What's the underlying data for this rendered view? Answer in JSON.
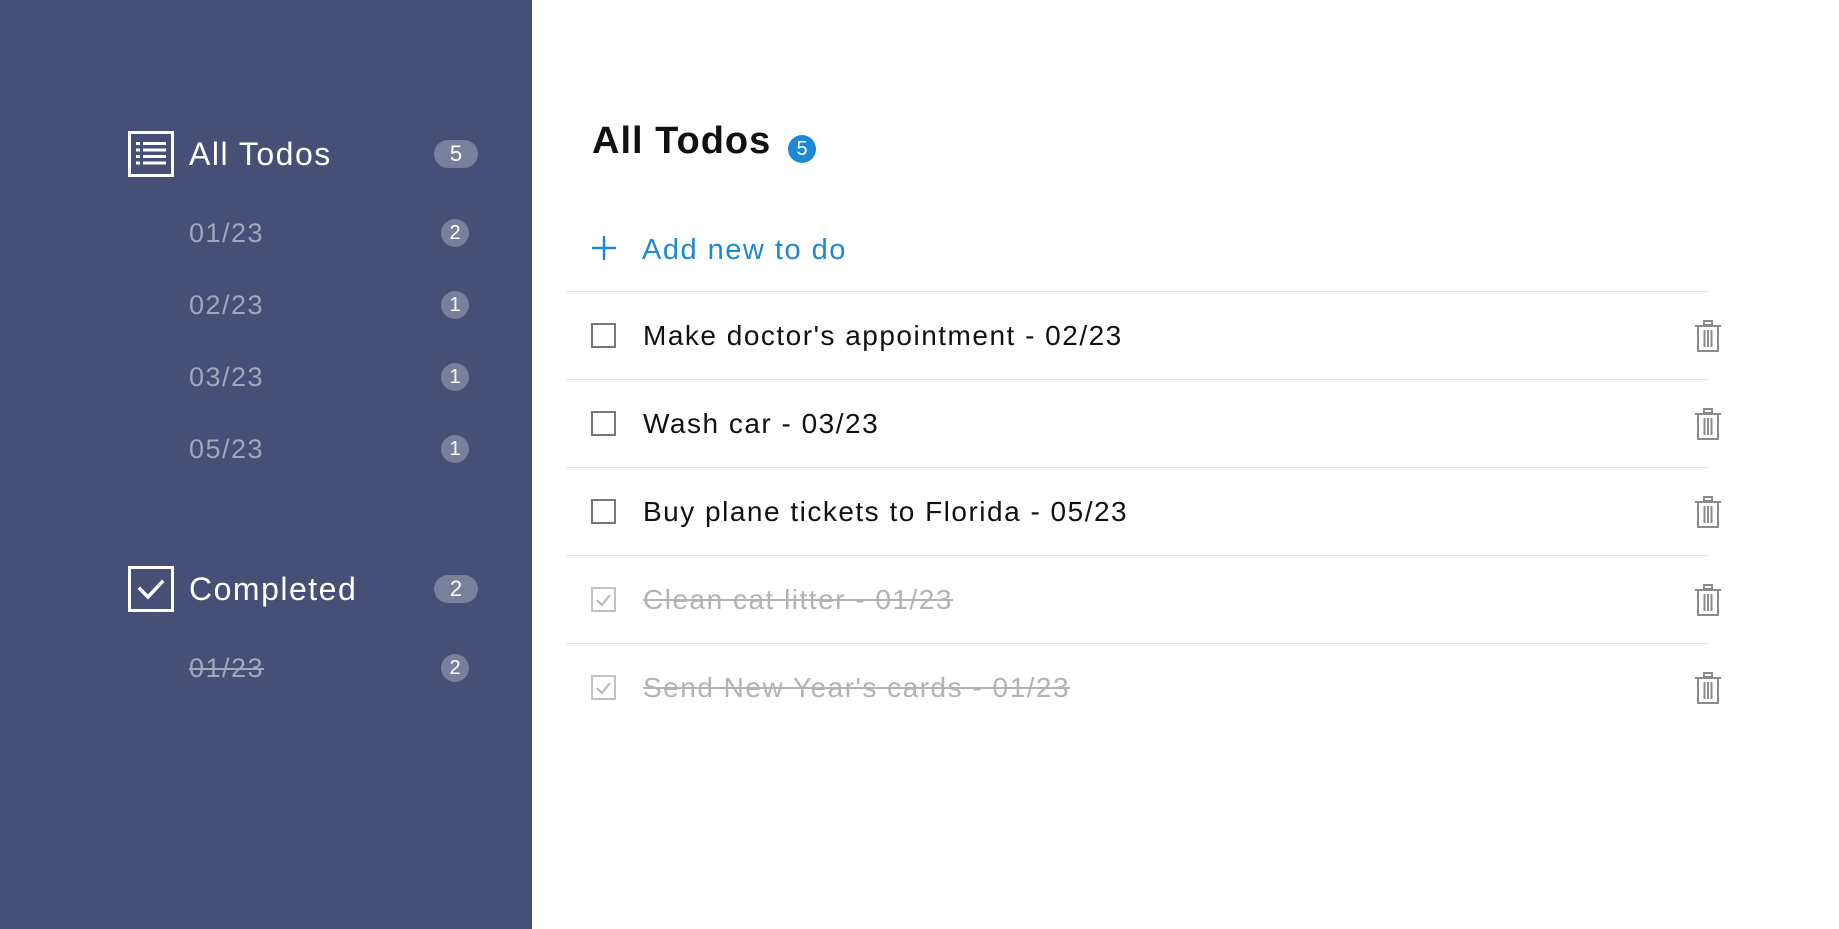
{
  "sidebar": {
    "all": {
      "icon": "list-icon",
      "label": "All Todos",
      "count": "5",
      "items": [
        {
          "label": "01/23",
          "count": "2"
        },
        {
          "label": "02/23",
          "count": "1"
        },
        {
          "label": "03/23",
          "count": "1"
        },
        {
          "label": "05/23",
          "count": "1"
        }
      ]
    },
    "completed": {
      "icon": "checkmark-box-icon",
      "label": "Completed",
      "count": "2",
      "items": [
        {
          "label": "01/23",
          "count": "2"
        }
      ]
    }
  },
  "main": {
    "title": "All Todos",
    "count": "5",
    "add_icon": "plus-icon",
    "add_label": "Add new to do",
    "todos": [
      {
        "text": "Make doctor's appointment - 02/23",
        "completed": false
      },
      {
        "text": "Wash car - 03/23",
        "completed": false
      },
      {
        "text": "Buy plane tickets to Florida - 05/23",
        "completed": false
      },
      {
        "text": "Clean cat litter - 01/23",
        "completed": true
      },
      {
        "text": "Send New Year's cards - 01/23",
        "completed": true
      }
    ]
  },
  "colors": {
    "sidebar_bg": "#474f76",
    "accent": "#1e88d2",
    "badge_bg": "#7a809c",
    "sidebar_sub_text": "#a2a6ba",
    "completed_text": "#b3b3b3"
  }
}
